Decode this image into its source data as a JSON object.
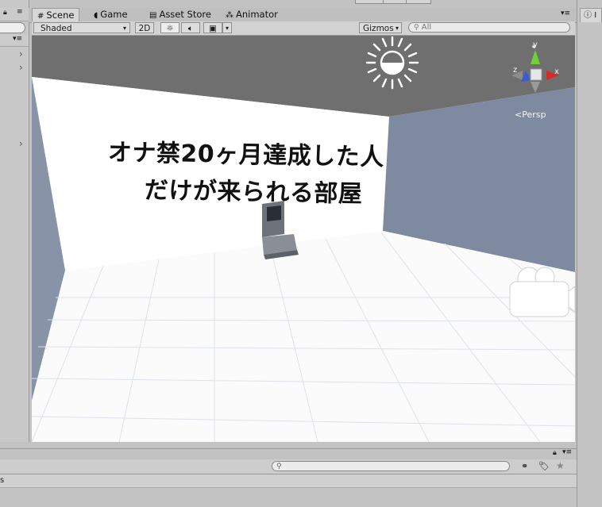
{
  "tabs": [
    {
      "label": "Scene",
      "icon": "grid-icon",
      "active": true
    },
    {
      "label": "Game",
      "icon": "pacman-icon",
      "active": false
    },
    {
      "label": "Asset Store",
      "icon": "store-icon",
      "active": false
    },
    {
      "label": "Animator",
      "icon": "animator-icon",
      "active": false
    }
  ],
  "toolbar": {
    "shading_mode": "Shaded",
    "mode_2d": "2D",
    "gizmos": "Gizmos",
    "search_placeholder": "All"
  },
  "scene": {
    "wall_text_line1": "オナ禁20ヶ月達成した人",
    "wall_text_line2": "だけが来られる部屋",
    "projection": "Persp",
    "axis_y": "y",
    "axis_x": "x",
    "axis_z": "z"
  },
  "right_panel": {
    "tab_label": "I",
    "tab_icon": "info-icon"
  },
  "bottom": {
    "row_text": "s"
  },
  "colors": {
    "scene_sky": "#6e6e6e",
    "scene_right_wall": "#7d8aa0",
    "scene_left_wall": "#8893a8",
    "gizmo_y": "#6fd13a",
    "gizmo_x": "#d62b2b",
    "gizmo_z": "#3a5bd6"
  }
}
